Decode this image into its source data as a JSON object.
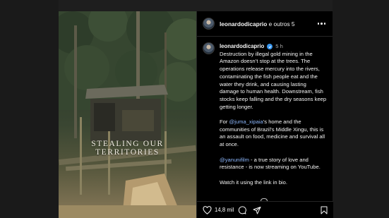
{
  "post": {
    "overlay_title": "STEALING OUR TERRITORIES"
  },
  "header": {
    "username": "leonardodicaprio",
    "extra": " e outros 5"
  },
  "comment": {
    "author": "leonardodicaprio",
    "time": "5 h",
    "paragraph1": "Destruction by illegal gold mining in the Amazon doesn’t stop at the trees. The operations release mercury into the rivers, contaminating the fish people eat and the water they drink, and causing lasting damage to human health. Downstream, fish stocks keep falling and the dry seasons keep getting longer.",
    "p2_before": "For ",
    "p2_mention": "@juma_xipaia",
    "p2_after": "’s home and the communities of Brazil’s Middle Xingu, this is an assault on food, medicine and survival all at once.",
    "p3_mention": "@yanunifilm",
    "p3_after": " - a true story of love and resistance - is now streaming on YouTube.",
    "paragraph4": "Watch it using the link in bio."
  },
  "actions": {
    "like_count": "14,8 mil",
    "icons": [
      "heart-icon",
      "comment-icon",
      "share-icon",
      "save-icon"
    ]
  },
  "colors": {
    "panel_bg": "#000000",
    "mention": "#8ab4f8",
    "verified": "#3897f0",
    "secondary_text": "#a8a8a8"
  }
}
